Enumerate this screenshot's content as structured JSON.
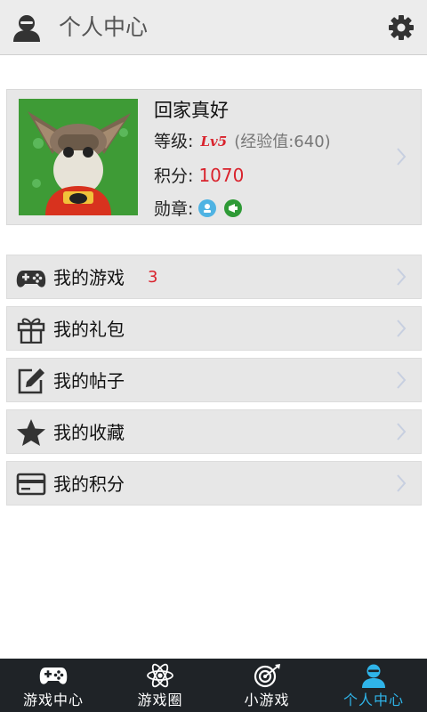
{
  "header": {
    "title": "个人中心"
  },
  "profile": {
    "name": "回家真好",
    "level_label": "等级:",
    "level_badge": "Lv5",
    "exp_text": "(经验值:640)",
    "points_label": "积分:",
    "points_value": "1070",
    "medals_label": "勋章:"
  },
  "menu": [
    {
      "label": "我的游戏",
      "count": "3",
      "icon": "gamepad-icon"
    },
    {
      "label": "我的礼包",
      "count": "",
      "icon": "gift-icon"
    },
    {
      "label": "我的帖子",
      "count": "",
      "icon": "edit-icon"
    },
    {
      "label": "我的收藏",
      "count": "",
      "icon": "star-icon"
    },
    {
      "label": "我的积分",
      "count": "",
      "icon": "card-icon"
    }
  ],
  "tabs": [
    {
      "label": "游戏中心",
      "icon": "gamepad-icon"
    },
    {
      "label": "游戏圈",
      "icon": "atom-icon"
    },
    {
      "label": "小游戏",
      "icon": "target-icon"
    },
    {
      "label": "个人中心",
      "icon": "user-icon",
      "active": true
    }
  ],
  "colors": {
    "accent": "#2fb4e9",
    "highlight": "#d9232d",
    "tabbar": "#1f2327",
    "row": "#e7e7e7"
  }
}
